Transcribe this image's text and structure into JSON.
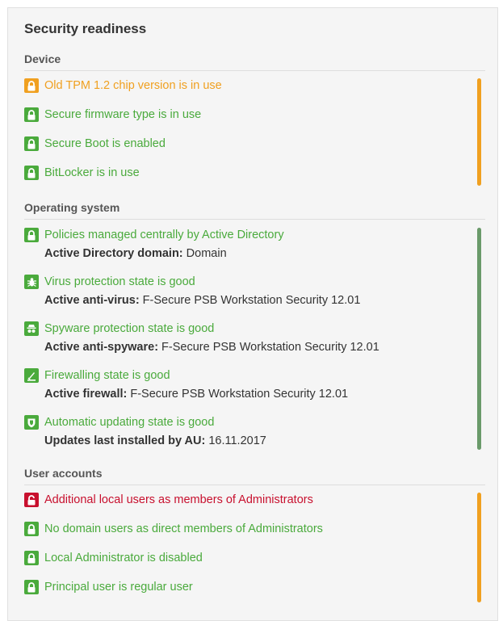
{
  "title": "Security readiness",
  "colors": {
    "green": "#4aaa3c",
    "orange": "#f0a020",
    "red": "#c8102e",
    "bar_orange": "#f0a020",
    "bar_green": "#6a9a6a"
  },
  "device": {
    "heading": "Device",
    "items": [
      {
        "label": "Old TPM 1.2 chip version is in use",
        "icon": "lock-icon",
        "status": "orange"
      },
      {
        "label": "Secure firmware type is in use",
        "icon": "lock-icon",
        "status": "green"
      },
      {
        "label": "Secure Boot is enabled",
        "icon": "lock-icon",
        "status": "green"
      },
      {
        "label": "BitLocker is in use",
        "icon": "lock-icon",
        "status": "green"
      }
    ]
  },
  "os": {
    "heading": "Operating system",
    "items": [
      {
        "label": "Policies managed centrally by Active Directory",
        "icon": "lock-icon",
        "status": "green",
        "detail_key": "Active Directory domain:",
        "detail_value": "Domain"
      },
      {
        "label": "Virus protection state is good",
        "icon": "bug-icon",
        "status": "green",
        "detail_key": "Active anti-virus:",
        "detail_value": "F-Secure PSB Workstation Security 12.01"
      },
      {
        "label": "Spyware protection state is good",
        "icon": "spy-icon",
        "status": "green",
        "detail_key": "Active anti-spyware:",
        "detail_value": "F-Secure PSB Workstation Security 12.01"
      },
      {
        "label": "Firewalling state is good",
        "icon": "firewall-icon",
        "status": "green",
        "detail_key": "Active firewall:",
        "detail_value": "F-Secure PSB Workstation Security 12.01"
      },
      {
        "label": "Automatic updating state is good",
        "icon": "shield-icon",
        "status": "green",
        "detail_key": "Updates last installed by AU:",
        "detail_value": "16.11.2017"
      }
    ]
  },
  "users": {
    "heading": "User accounts",
    "items": [
      {
        "label": "Additional local users as members of Administrators",
        "icon": "unlock-icon",
        "status": "red"
      },
      {
        "label": "No domain users as direct members of Administrators",
        "icon": "lock-icon",
        "status": "green"
      },
      {
        "label": "Local Administrator is disabled",
        "icon": "lock-icon",
        "status": "green"
      },
      {
        "label": "Principal user is regular user",
        "icon": "lock-icon",
        "status": "green"
      }
    ]
  }
}
